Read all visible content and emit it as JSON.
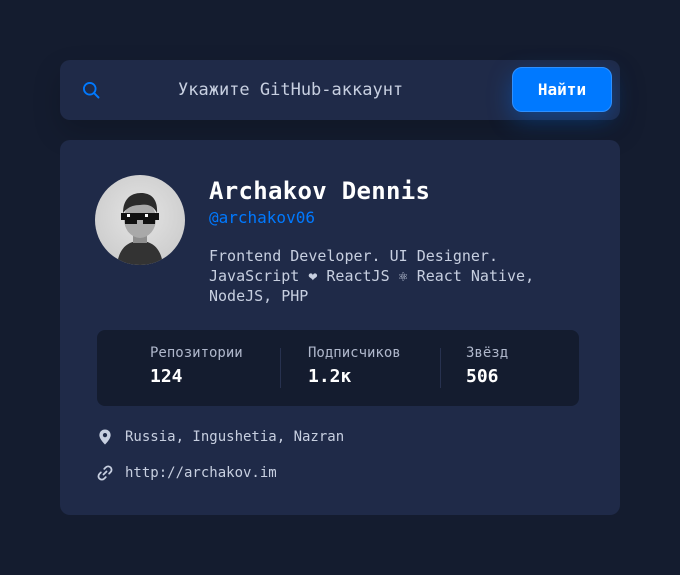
{
  "colors": {
    "page_bg": "#141c2f",
    "card_bg": "#1f2a48",
    "accent": "#0079ff",
    "text_primary": "#ffffff",
    "text_secondary": "#c7cfe0"
  },
  "search": {
    "icon": "search-icon",
    "placeholder": "Укажите GitHub-аккаунт",
    "value": "",
    "button_label": "Найти"
  },
  "profile": {
    "avatar": "avatar-photo",
    "name": "Archakov Dennis",
    "login": "@archakov06",
    "bio_lines": [
      "Frontend Developer. UI Designer.",
      "JavaScript ❤ ReactJS ⚛ React Native,",
      "NodeJS, PHP"
    ]
  },
  "stats": [
    {
      "label": "Репозитории",
      "value": "124"
    },
    {
      "label": "Подписчиков",
      "value": "1.2к"
    },
    {
      "label": "Звёзд",
      "value": "506"
    }
  ],
  "info": {
    "location_icon": "map-pin-icon",
    "location": "Russia, Ingushetia, Nazran",
    "website_icon": "link-icon",
    "website": "http://archakov.im"
  }
}
